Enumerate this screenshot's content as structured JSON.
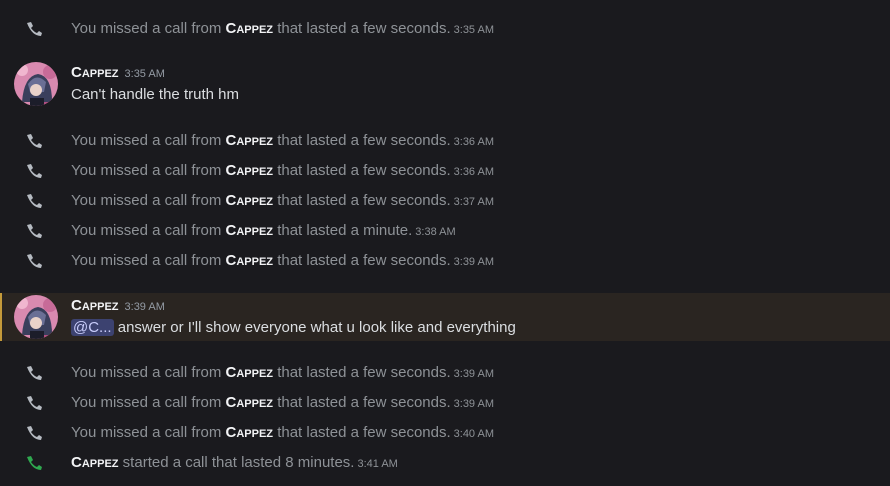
{
  "colors": {
    "missed_icon": "#b5bac1",
    "started_icon": "#2fa84f",
    "mention_bar": "#c49a3a"
  },
  "events": [
    {
      "prefix": "You missed a call from ",
      "name": "Cappez",
      "suffix": " that lasted a few seconds.",
      "time": "3:35 AM",
      "icon": "phone-missed-icon"
    },
    {
      "prefix": "You missed a call from ",
      "name": "Cappez",
      "suffix": " that lasted a few seconds.",
      "time": "3:36 AM",
      "icon": "phone-missed-icon"
    },
    {
      "prefix": "You missed a call from ",
      "name": "Cappez",
      "suffix": " that lasted a few seconds.",
      "time": "3:36 AM",
      "icon": "phone-missed-icon"
    },
    {
      "prefix": "You missed a call from ",
      "name": "Cappez",
      "suffix": " that lasted a few seconds.",
      "time": "3:37 AM",
      "icon": "phone-missed-icon"
    },
    {
      "prefix": "You missed a call from ",
      "name": "Cappez",
      "suffix": " that lasted a minute.",
      "time": "3:38 AM",
      "icon": "phone-missed-icon"
    },
    {
      "prefix": "You missed a call from ",
      "name": "Cappez",
      "suffix": " that lasted a few seconds.",
      "time": "3:39 AM",
      "icon": "phone-missed-icon"
    },
    {
      "prefix": "You missed a call from ",
      "name": "Cappez",
      "suffix": " that lasted a few seconds.",
      "time": "3:39 AM",
      "icon": "phone-missed-icon"
    },
    {
      "prefix": "You missed a call from ",
      "name": "Cappez",
      "suffix": " that lasted a few seconds.",
      "time": "3:39 AM",
      "icon": "phone-missed-icon"
    },
    {
      "prefix": "You missed a call from ",
      "name": "Cappez",
      "suffix": " that lasted a few seconds.",
      "time": "3:40 AM",
      "icon": "phone-missed-icon"
    },
    {
      "prefix": "",
      "name": "Cappez",
      "suffix": " started a call that lasted 8 minutes.",
      "time": "3:41 AM",
      "icon": "phone-started-icon"
    }
  ],
  "messages": [
    {
      "author": "Cappez",
      "time": "3:35 AM",
      "mention": "",
      "text": "Can't handle the truth hm"
    },
    {
      "author": "Cappez",
      "time": "3:39 AM",
      "mention": "@C...",
      "text": " answer or I'll show everyone what u look like and everything"
    }
  ]
}
